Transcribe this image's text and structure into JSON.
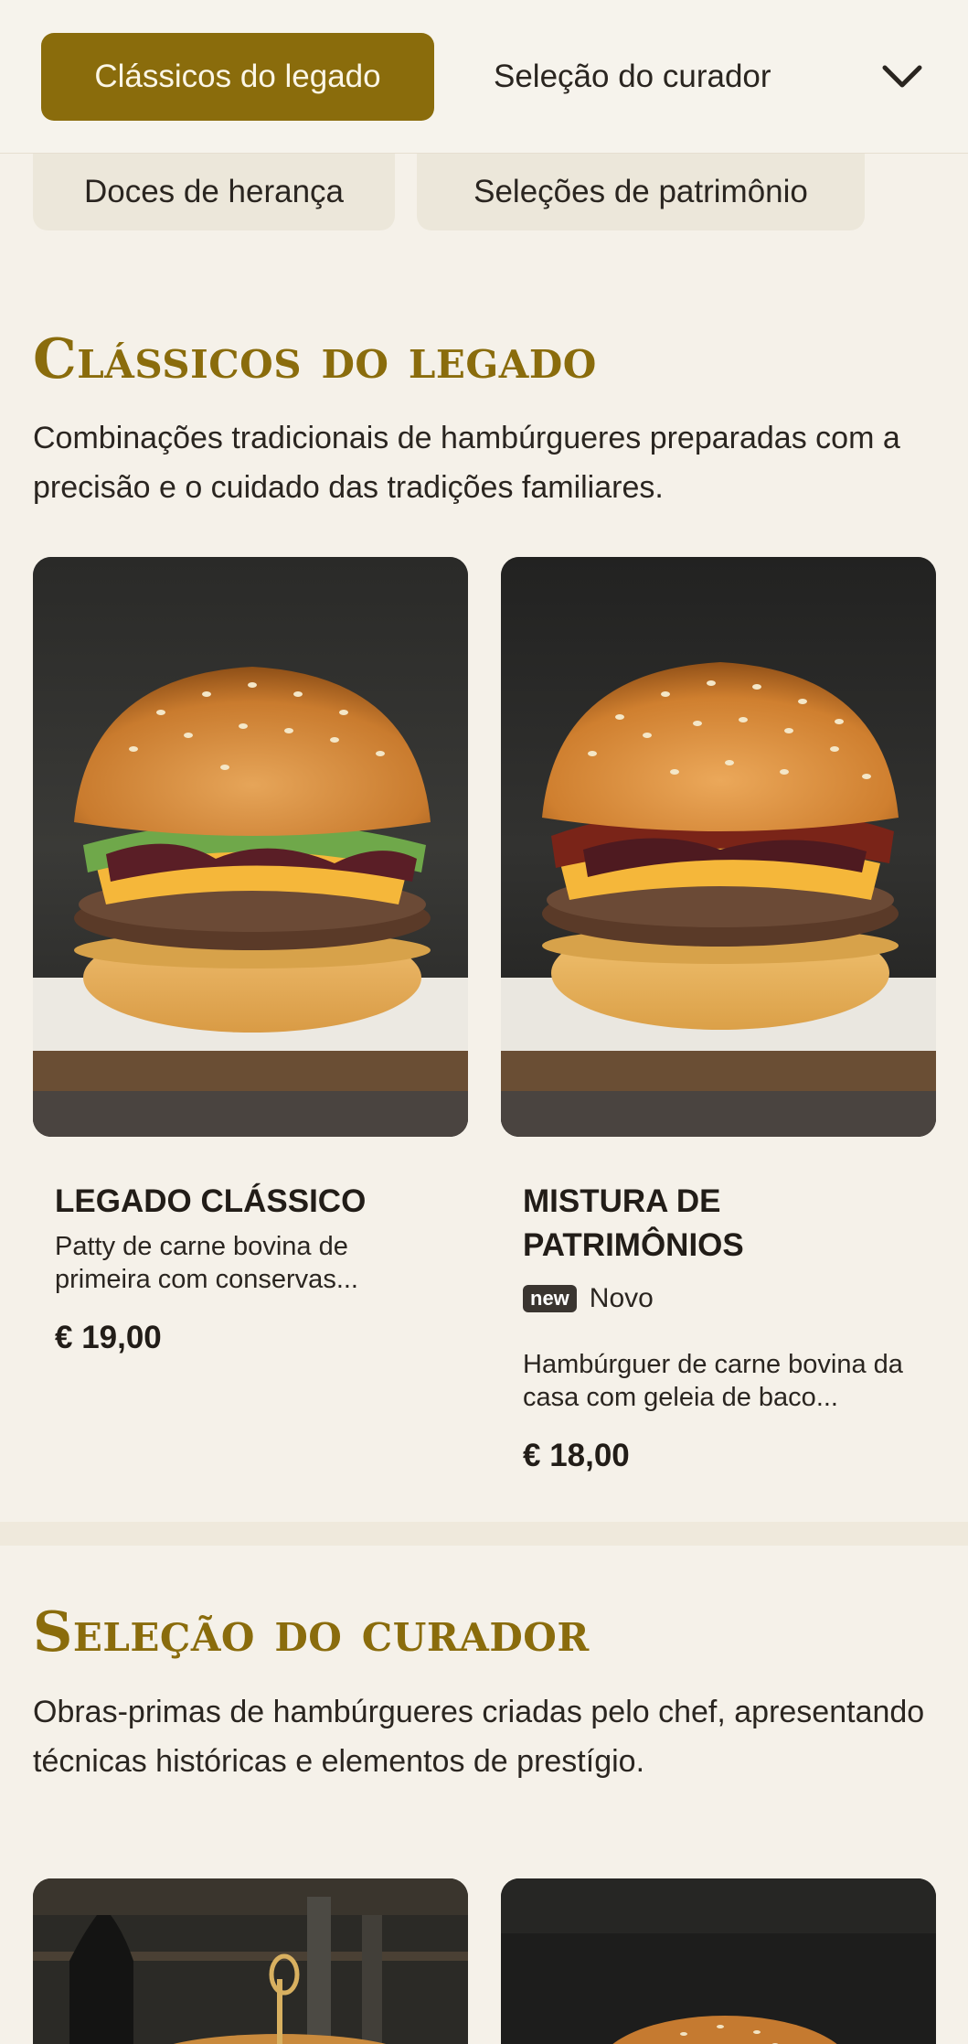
{
  "nav": {
    "active_category": "Clássicos do legado",
    "next_category": "Seleção do curador",
    "more_categories": [
      "Doces de herança",
      "Seleções de patrimônio"
    ]
  },
  "sections": [
    {
      "title": "Clássicos do legado",
      "description": "Combinações tradicionais de hambúrgueres preparadas com a precisão e o cuidado das tradições familiares.",
      "items": [
        {
          "name": "LEGADO CLÁSSICO",
          "description": "Patty de carne bovina de primeira com conservas...",
          "price": "€ 19,00"
        },
        {
          "name": "MISTURA DE PATRIMÔNIOS",
          "badge": "new",
          "badge_label": "Novo",
          "description": "Hambúrguer de carne bovina da casa com geleia de baco...",
          "price": "€ 18,00"
        }
      ]
    },
    {
      "title": "Seleção do curador",
      "description": "Obras-primas de hambúrgueres criadas pelo chef, apresentando técnicas históricas e elementos de prestígio."
    }
  ],
  "colors": {
    "accent": "#8a6c0c",
    "background": "#f5f1e9",
    "chip": "#ece7da"
  },
  "icons": {
    "category_dropdown": "chevron-down-icon"
  }
}
